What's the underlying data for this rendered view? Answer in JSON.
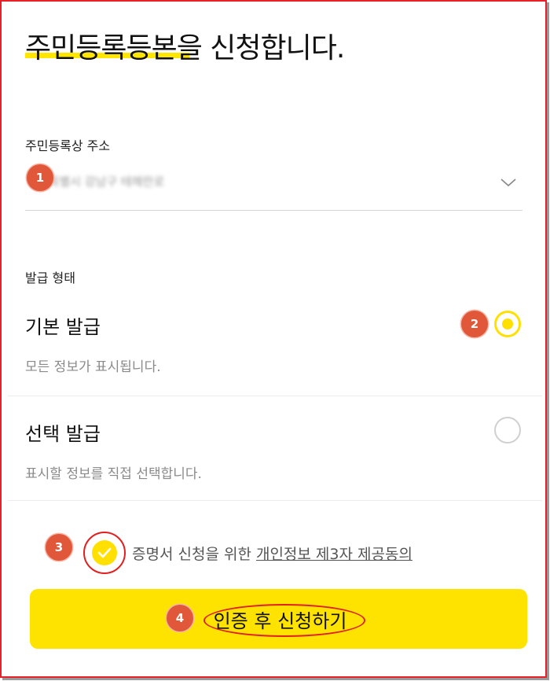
{
  "page": {
    "title": "주민등록등본을 신청합니다."
  },
  "address": {
    "label": "주민등록상 주소",
    "value_blurred": "서울특별시 강남구 테헤란로"
  },
  "issue_type": {
    "label": "발급 형태",
    "options": [
      {
        "title": "기본 발급",
        "desc": "모든 정보가 표시됩니다.",
        "selected": true
      },
      {
        "title": "선택 발급",
        "desc": "표시할 정보를 직접 선택합니다.",
        "selected": false
      }
    ]
  },
  "consent": {
    "text": "증명서 신청을 위한 ",
    "link": "개인정보 제3자 제공동의",
    "checked": true
  },
  "submit": {
    "label": "인증 후 신청하기"
  },
  "badges": [
    "1",
    "2",
    "3",
    "4"
  ],
  "colors": {
    "accent_yellow": "#ffe300",
    "badge_orange": "#e0573a",
    "frame_red": "#e8202a"
  }
}
